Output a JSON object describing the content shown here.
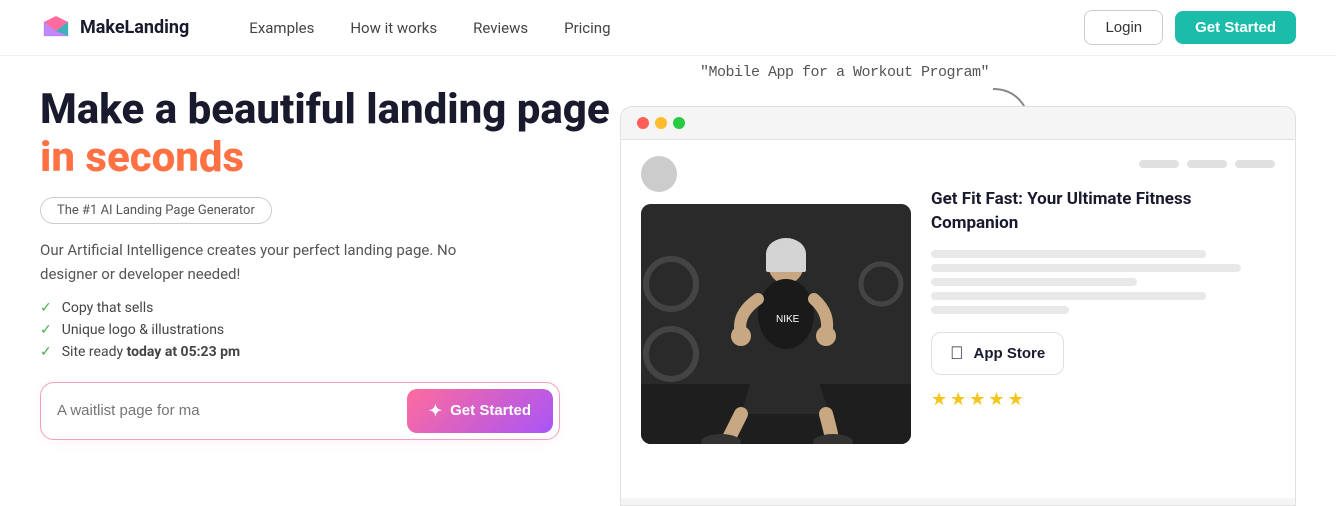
{
  "navbar": {
    "logo_text": "MakeLanding",
    "links": [
      {
        "label": "Examples",
        "id": "examples"
      },
      {
        "label": "How it works",
        "id": "how-it-works"
      },
      {
        "label": "Reviews",
        "id": "reviews"
      },
      {
        "label": "Pricing",
        "id": "pricing"
      }
    ],
    "login_label": "Login",
    "get_started_label": "Get Started"
  },
  "hero": {
    "headline_line1": "Make a beautiful landing page",
    "headline_accent": "in seconds",
    "badge": "The #1 AI Landing Page Generator",
    "description": "Our Artificial Intelligence creates your perfect landing page. No designer or developer needed!",
    "checklist": [
      {
        "text": "Copy that sells"
      },
      {
        "text": "Unique logo & illustrations"
      },
      {
        "text": "Site ready ",
        "bold": "today at 05:23 pm"
      }
    ],
    "input_placeholder": "A waitlist page for ma",
    "get_started_label": "Get Started"
  },
  "preview": {
    "handwritten_label": "\"Mobile App for a Workout Program\"",
    "arrow": "↷",
    "browser": {
      "app_title": "Get Fit Fast: Your Ultimate Fitness Companion",
      "app_store_label": "App Store",
      "stars": [
        "★",
        "★",
        "★",
        "★",
        "★"
      ]
    }
  },
  "icons": {
    "sparkle": "✦",
    "check": "✓",
    "apple": ""
  }
}
